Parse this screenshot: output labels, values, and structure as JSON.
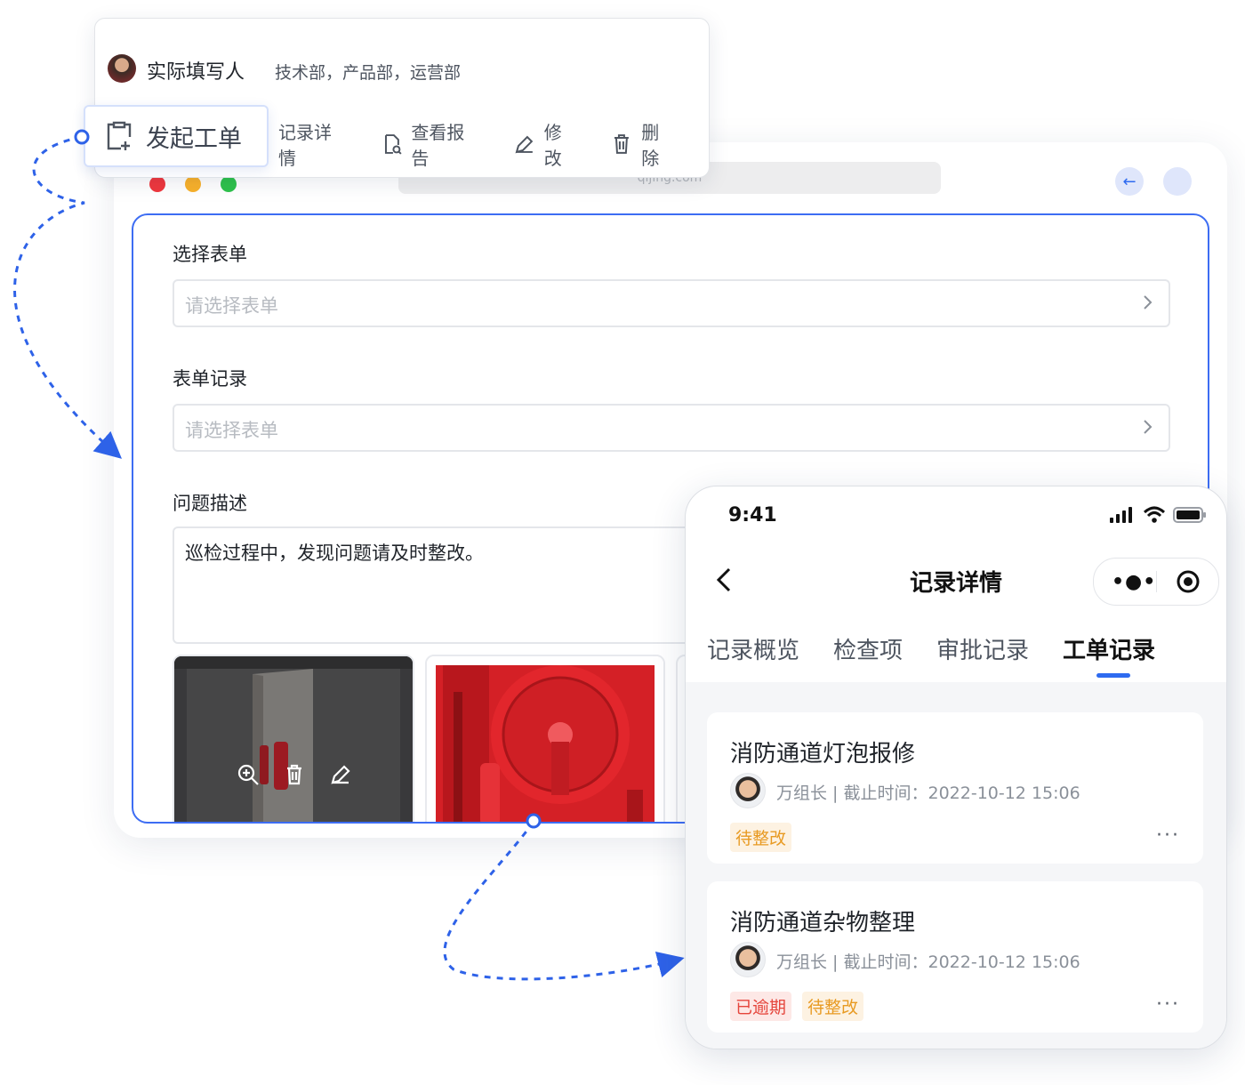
{
  "popup": {
    "filler_label": "实际填写人",
    "departments": "技术部，产品部，运营部",
    "actions": [
      "记录详情",
      "查看报告",
      "修改",
      "删除"
    ],
    "start_button": "发起工单"
  },
  "browser": {
    "url": "qijing.com"
  },
  "form": {
    "select_form": {
      "label": "选择表单",
      "placeholder": "请选择表单"
    },
    "form_record": {
      "label": "表单记录",
      "placeholder": "请选择表单"
    },
    "problem": {
      "label": "问题描述",
      "value": "巡检过程中，发现问题请及时整改。"
    }
  },
  "phone": {
    "time": "9:41",
    "title": "记录详情",
    "tabs": [
      "记录概览",
      "检查项",
      "审批记录",
      "工单记录"
    ],
    "active_tab": "工单记录",
    "cards": [
      {
        "title": "消防通道灯泡报修",
        "meta": "万组长 | 截止时间：2022-10-12 15:06",
        "tags": [
          "待整改"
        ]
      },
      {
        "title": "消防通道杂物整理",
        "meta": "万组长 | 截止时间：2022-10-12 15:06",
        "tags": [
          "已逾期",
          "待整改"
        ]
      }
    ],
    "more": "···"
  },
  "colors": {
    "accent": "#2e6bf0",
    "panel_border": "#3d6df3",
    "tag_warn": "#e89a22",
    "tag_danger": "#e5453c"
  },
  "icons": [
    "add-clipboard-icon",
    "file-search-icon",
    "edit-icon",
    "trash-icon",
    "zoom-in-icon",
    "chevron-right-icon",
    "back-arrow-icon",
    "signal-icon",
    "wifi-icon",
    "battery-icon",
    "more-dots-icon",
    "record-target-icon"
  ]
}
